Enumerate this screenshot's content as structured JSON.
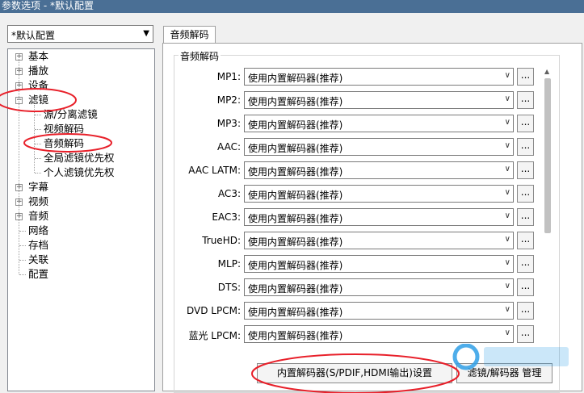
{
  "window": {
    "title": "参数选项 - *默认配置"
  },
  "profile": {
    "selected": "*默认配置"
  },
  "tree": {
    "items": [
      {
        "label": "基本",
        "expander": "+"
      },
      {
        "label": "播放",
        "expander": "+"
      },
      {
        "label": "设备",
        "expander": "+"
      },
      {
        "label": "滤镜",
        "expander": "-"
      },
      {
        "label": "源/分离滤镜",
        "expander": ""
      },
      {
        "label": "视频解码",
        "expander": ""
      },
      {
        "label": "音频解码",
        "expander": ""
      },
      {
        "label": "全局滤镜优先权",
        "expander": ""
      },
      {
        "label": "个人滤镜优先权",
        "expander": ""
      },
      {
        "label": "字幕",
        "expander": "+"
      },
      {
        "label": "视频",
        "expander": "+"
      },
      {
        "label": "音频",
        "expander": "+"
      },
      {
        "label": "网络",
        "expander": ""
      },
      {
        "label": "存档",
        "expander": ""
      },
      {
        "label": "关联",
        "expander": ""
      },
      {
        "label": "配置",
        "expander": ""
      }
    ]
  },
  "tab": {
    "label": "音频解码"
  },
  "group": {
    "title": "音频解码"
  },
  "decoders": {
    "rows": [
      {
        "label": "MP1:",
        "value": "使用内置解码器(推荐)",
        "button": "..."
      },
      {
        "label": "MP2:",
        "value": "使用内置解码器(推荐)",
        "button": "..."
      },
      {
        "label": "MP3:",
        "value": "使用内置解码器(推荐)",
        "button": "..."
      },
      {
        "label": "AAC:",
        "value": "使用内置解码器(推荐)",
        "button": "..."
      },
      {
        "label": "AAC LATM:",
        "value": "使用内置解码器(推荐)",
        "button": "..."
      },
      {
        "label": "AC3:",
        "value": "使用内置解码器(推荐)",
        "button": "..."
      },
      {
        "label": "EAC3:",
        "value": "使用内置解码器(推荐)",
        "button": "..."
      },
      {
        "label": "TrueHD:",
        "value": "使用内置解码器(推荐)",
        "button": "..."
      },
      {
        "label": "MLP:",
        "value": "使用内置解码器(推荐)",
        "button": "..."
      },
      {
        "label": "DTS:",
        "value": "使用内置解码器(推荐)",
        "button": "..."
      },
      {
        "label": "DVD LPCM:",
        "value": "使用内置解码器(推荐)",
        "button": "..."
      },
      {
        "label": "蓝光 LPCM:",
        "value": "使用内置解码器(推荐)",
        "button": "..."
      }
    ]
  },
  "buttons": {
    "builtin_settings": "内置解码器(S/PDIF,HDMI输出)设置",
    "filter_manager": "滤镜/解码器 管理"
  },
  "annotation": {
    "color": "#e8202a"
  }
}
